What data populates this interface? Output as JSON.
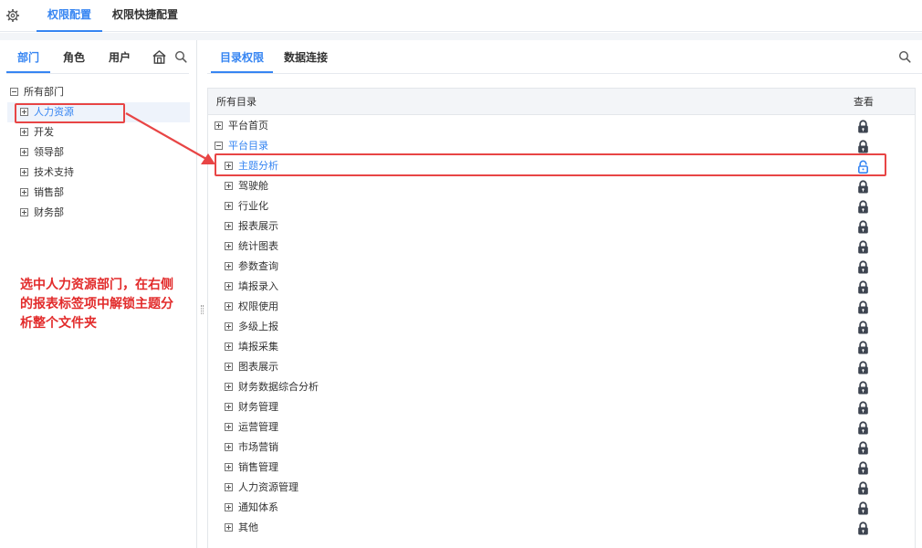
{
  "top": {
    "tabs": [
      {
        "label": "权限配置",
        "active": true
      },
      {
        "label": "权限快捷配置",
        "active": false
      }
    ]
  },
  "left": {
    "tabs": [
      {
        "label": "部门",
        "active": true
      },
      {
        "label": "角色",
        "active": false
      },
      {
        "label": "用户",
        "active": false
      }
    ],
    "tree": {
      "root": "所有部门",
      "children": [
        {
          "label": "人力资源",
          "selected": true
        },
        {
          "label": "开发"
        },
        {
          "label": "领导部"
        },
        {
          "label": "技术支持"
        },
        {
          "label": "销售部"
        },
        {
          "label": "财务部"
        }
      ]
    },
    "annotation": "选中人力资源部门，在右侧的报表标签项中解锁主题分析整个文件夹"
  },
  "right": {
    "tabs": [
      {
        "label": "目录权限",
        "active": true
      },
      {
        "label": "数据连接",
        "active": false
      }
    ],
    "table": {
      "header_name": "所有目录",
      "header_view": "查看",
      "rows": [
        {
          "label": "平台首页",
          "level": 0,
          "expanded": false,
          "lock": "locked"
        },
        {
          "label": "平台目录",
          "level": 0,
          "expanded": true,
          "lock": "locked",
          "highlight": true
        },
        {
          "label": "主题分析",
          "level": 1,
          "expanded": false,
          "lock": "unlocked",
          "highlight": true
        },
        {
          "label": "驾驶舱",
          "level": 1,
          "expanded": false,
          "lock": "locked"
        },
        {
          "label": "行业化",
          "level": 1,
          "expanded": false,
          "lock": "locked"
        },
        {
          "label": "报表展示",
          "level": 1,
          "expanded": false,
          "lock": "locked"
        },
        {
          "label": "统计图表",
          "level": 1,
          "expanded": false,
          "lock": "locked"
        },
        {
          "label": "参数查询",
          "level": 1,
          "expanded": false,
          "lock": "locked"
        },
        {
          "label": "填报录入",
          "level": 1,
          "expanded": false,
          "lock": "locked"
        },
        {
          "label": "权限使用",
          "level": 1,
          "expanded": false,
          "lock": "locked"
        },
        {
          "label": "多级上报",
          "level": 1,
          "expanded": false,
          "lock": "locked"
        },
        {
          "label": "填报采集",
          "level": 1,
          "expanded": false,
          "lock": "locked"
        },
        {
          "label": "图表展示",
          "level": 1,
          "expanded": false,
          "lock": "locked"
        },
        {
          "label": "财务数据综合分析",
          "level": 1,
          "expanded": false,
          "lock": "locked"
        },
        {
          "label": "财务管理",
          "level": 1,
          "expanded": false,
          "lock": "locked"
        },
        {
          "label": "运营管理",
          "level": 1,
          "expanded": false,
          "lock": "locked"
        },
        {
          "label": "市场营销",
          "level": 1,
          "expanded": false,
          "lock": "locked"
        },
        {
          "label": "销售管理",
          "level": 1,
          "expanded": false,
          "lock": "locked"
        },
        {
          "label": "人力资源管理",
          "level": 1,
          "expanded": false,
          "lock": "locked"
        },
        {
          "label": "通知体系",
          "level": 1,
          "expanded": false,
          "lock": "locked"
        },
        {
          "label": "其他",
          "level": 1,
          "expanded": false,
          "lock": "locked"
        }
      ]
    }
  },
  "colors": {
    "accent": "#3685f2",
    "annotation_red": "#e84545",
    "lock_dark": "#3d4450"
  },
  "icons": {
    "settings": "gear-icon",
    "home": "home-icon",
    "search": "search-icon",
    "locked": "lock-icon",
    "unlocked": "unlock-icon"
  }
}
